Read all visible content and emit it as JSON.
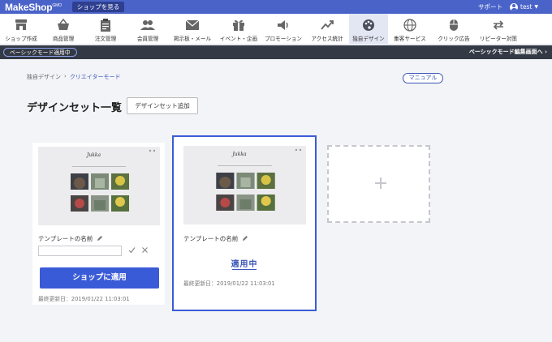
{
  "topbar": {
    "logo": "MakeShop",
    "logo_suffix": "GMO",
    "shop_button": "ショップを見る",
    "support": "サポート",
    "user": "test"
  },
  "nav": {
    "items": [
      {
        "label": "ショップ作成",
        "icon": "shop-icon"
      },
      {
        "label": "商品管理",
        "icon": "basket-icon"
      },
      {
        "label": "注文管理",
        "icon": "clipboard-icon"
      },
      {
        "label": "会員管理",
        "icon": "members-icon"
      },
      {
        "label": "掲示板・メール",
        "icon": "mail-icon"
      },
      {
        "label": "イベント・企画",
        "icon": "gift-icon"
      },
      {
        "label": "プロモーション",
        "icon": "speaker-icon"
      },
      {
        "label": "アクセス統計",
        "icon": "trend-icon"
      },
      {
        "label": "独自デザイン",
        "icon": "palette-icon",
        "active": true
      },
      {
        "label": "集客サービス",
        "icon": "globe-icon"
      },
      {
        "label": "クリック広告",
        "icon": "mouse-icon"
      },
      {
        "label": "リピーター対策",
        "icon": "repeat-icon"
      }
    ]
  },
  "modebar": {
    "badge": "ベーシックモード適用中",
    "link": "ベーシックモード編集画面へ ›"
  },
  "breadcrumb": {
    "parent": "独自デザイン",
    "separator": "›",
    "current": "クリエイターモード"
  },
  "manual": "マニュアル",
  "page": {
    "title": "デザインセット一覧",
    "add_button": "デザインセット追加"
  },
  "cards": [
    {
      "name": "テンプレートの名前",
      "input_value": "",
      "apply_button": "ショップに適用",
      "updated": "最終更新日：2019/01/22 11:03:01"
    },
    {
      "name": "テンプレートの名前",
      "status": "適用中",
      "updated": "最終更新日：2019/01/22 11:03:01"
    }
  ],
  "colors": {
    "brand": "#4a63c9",
    "accent": "#3a5bd8",
    "dark": "#343a45"
  }
}
